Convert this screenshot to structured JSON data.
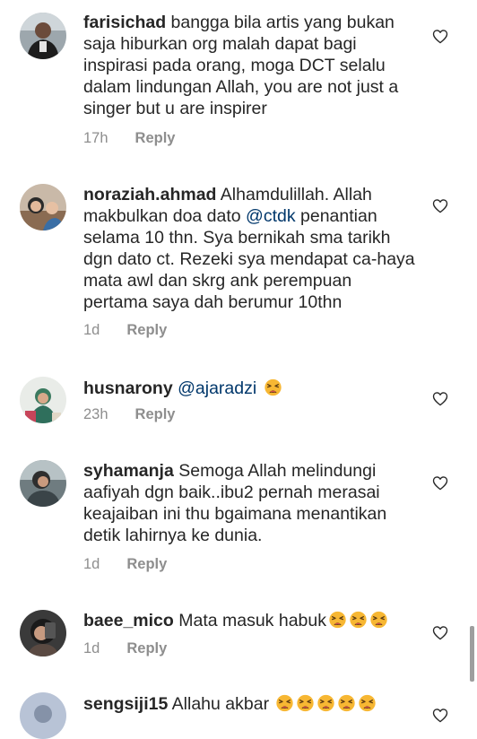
{
  "comments": [
    {
      "username": "farisichad",
      "text": " bangga bila artis yang bukan saja hiburkan org malah dapat bagi inspirasi pada orang, moga DCT selalu dalam lindungan Allah, you are not just a singer but u are inspirer",
      "time": "17h",
      "reply_label": "Reply"
    },
    {
      "username": "noraziah.ahmad",
      "text_before": " Alhamdulillah. Allah makbulkan doa dato ",
      "mention": "@ctdk",
      "text_after": " penantian selama 10 thn. Sya bernikah sma tarikh dgn dato ct. Rezeki sya mendapat ca-haya mata awl dan skrg ank perempuan pertama saya dah berumur 10thn",
      "time": "1d",
      "reply_label": "Reply"
    },
    {
      "username": "husnarony",
      "mention": "@ajaradzi",
      "emoji": "tired-face-emoji",
      "time": "23h",
      "reply_label": "Reply"
    },
    {
      "username": "syhamanja",
      "text": " Semoga Allah melindungi aafiyah dgn baik..ibu2 pernah merasai keajaiban ini thu bgaimana menantikan detik lahirnya ke dunia.",
      "time": "1d",
      "reply_label": "Reply"
    },
    {
      "username": "baee_mico",
      "text": " Mata masuk habuk",
      "emoji": "tired-face-emoji",
      "emoji_count": 3,
      "time": "1d",
      "reply_label": "Reply"
    },
    {
      "username": "sengsiji15",
      "text": " Allahu akbar ",
      "emoji": "tired-face-emoji",
      "emoji_count": 5
    }
  ],
  "icons": {
    "like": "heart-outline-icon"
  },
  "colors": {
    "text": "#262626",
    "mention": "#00376b",
    "meta": "#8e8e8e",
    "emoji": "#f7b733"
  }
}
